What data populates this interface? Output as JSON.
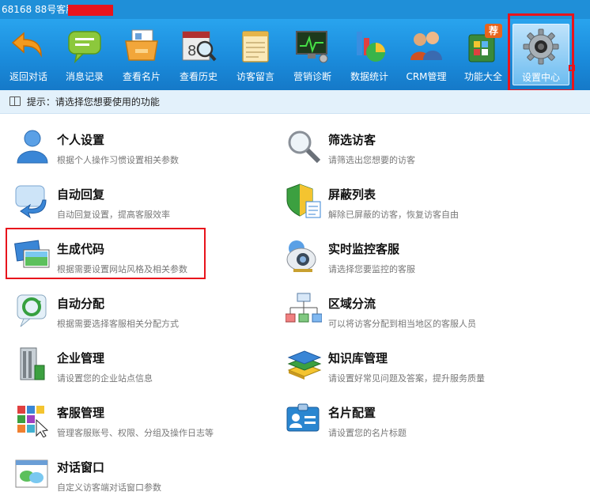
{
  "window": {
    "title": "68168 88号客服"
  },
  "toolbar": {
    "items": [
      {
        "label": "返回对话",
        "icon": "back-arrow-icon"
      },
      {
        "label": "消息记录",
        "icon": "message-bubble-icon"
      },
      {
        "label": "查看名片",
        "icon": "card-folder-icon"
      },
      {
        "label": "查看历史",
        "icon": "calendar-search-icon"
      },
      {
        "label": "访客留言",
        "icon": "notepad-icon"
      },
      {
        "label": "营销诊断",
        "icon": "monitor-stethoscope-icon"
      },
      {
        "label": "数据统计",
        "icon": "bar-pie-chart-icon"
      },
      {
        "label": "CRM管理",
        "icon": "people-icon"
      },
      {
        "label": "功能大全",
        "icon": "apps-bag-icon",
        "badge": "荐"
      },
      {
        "label": "设置中心",
        "icon": "gear-icon",
        "active": true
      }
    ]
  },
  "hint": {
    "text": "提示：请选择您想要使用的功能"
  },
  "settings": {
    "left": [
      {
        "title": "个人设置",
        "desc": "根据个人操作习惯设置相关参数",
        "icon": "person-icon"
      },
      {
        "title": "自动回复",
        "desc": "自动回复设置，提高客服效率",
        "icon": "auto-reply-icon"
      },
      {
        "title": "生成代码",
        "desc": "根据需要设置网站风格及相关参数",
        "icon": "code-windows-icon",
        "highlighted": true
      },
      {
        "title": "自动分配",
        "desc": "根据需要选择客服相关分配方式",
        "icon": "refresh-cycle-icon"
      },
      {
        "title": "企业管理",
        "desc": "请设置您的企业站点信息",
        "icon": "building-icon"
      },
      {
        "title": "客服管理",
        "desc": "管理客服账号、权限、分组及操作日志等",
        "icon": "grid-cursor-icon"
      },
      {
        "title": "对话窗口",
        "desc": "自定义访客端对话窗口参数",
        "icon": "chat-window-icon"
      }
    ],
    "right": [
      {
        "title": "筛选访客",
        "desc": "请筛选出您想要的访客",
        "icon": "magnifier-icon"
      },
      {
        "title": "屏蔽列表",
        "desc": "解除已屏蔽的访客，恢复访客自由",
        "icon": "shield-list-icon"
      },
      {
        "title": "实时监控客服",
        "desc": "请选择您要监控的客服",
        "icon": "webcam-icon"
      },
      {
        "title": "区域分流",
        "desc": "可以将访客分配到相当地区的客服人员",
        "icon": "network-tree-icon"
      },
      {
        "title": "知识库管理",
        "desc": "请设置好常见问题及答案，提升服务质量",
        "icon": "books-icon"
      },
      {
        "title": "名片配置",
        "desc": "请设置您的名片标题",
        "icon": "id-card-icon"
      }
    ]
  },
  "colors": {
    "toolbar": "#1b8cdc",
    "highlight": "#e8141c",
    "hint_bg": "#e3f1fb"
  }
}
